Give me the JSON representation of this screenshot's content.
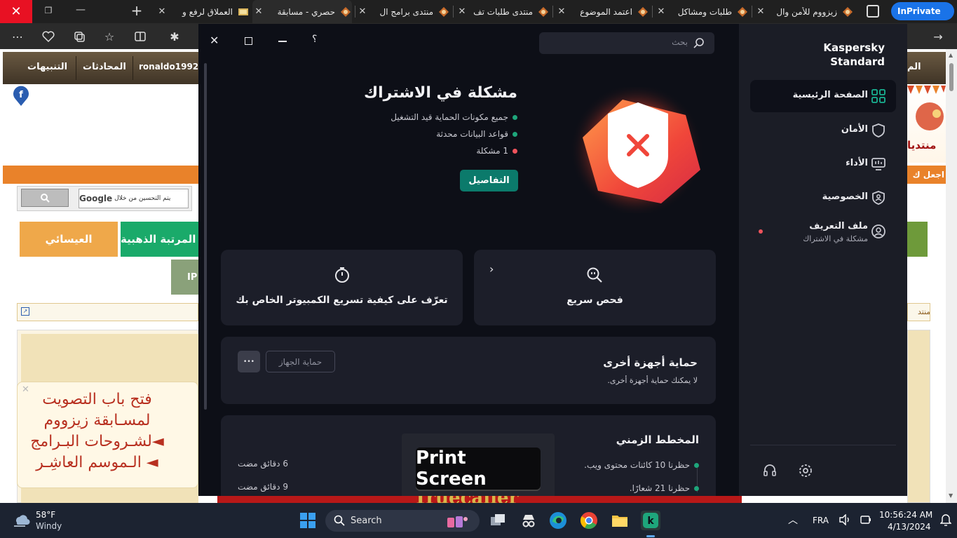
{
  "browser": {
    "tabs": [
      {
        "label": "العملاق لرفع و",
        "active": false
      },
      {
        "label": "حصري - مسابقة",
        "active": true
      },
      {
        "label": "منتدى برامج ال",
        "active": false
      },
      {
        "label": "منتدى طلبات تف",
        "active": false
      },
      {
        "label": "اعتمد الموضوع",
        "active": false
      },
      {
        "label": "طلبات ومشاكل",
        "active": false
      },
      {
        "label": "زيزووم للأمن وال",
        "active": false
      }
    ],
    "inprivate_label": "InPrivate"
  },
  "forum": {
    "nav": {
      "alerts": "التنبيهات",
      "conversations": "المحادثات",
      "username": "ronaldo1992"
    },
    "search_placeholder": "يتم التحسين من خلال",
    "google_word": "Google",
    "right_nav_label": "الم",
    "join_text": "اجعل ك",
    "brand_text": "منتديا",
    "rank_gold": "المرتبة الذهبية",
    "rank_other": "العيسائي",
    "ip_label": "IP",
    "breadcrumb_right": "المنتد",
    "announcement": {
      "line1": "فتح باب التصويت",
      "line2": "لمسـابقة زيزووم",
      "line3": "◄لشـروحات البـرامج",
      "line4": "◄ الـموسم العاشِـر"
    },
    "truecaller_text": "Truecaller"
  },
  "kaspersky": {
    "app_name_line1": "Kaspersky",
    "app_name_line2": "Standard",
    "search_placeholder": "بحث",
    "sidebar": [
      {
        "label": "الصفحة الرئيسية",
        "icon": "dashboard-icon",
        "active": true
      },
      {
        "label": "الأمان",
        "icon": "shield-icon",
        "active": false
      },
      {
        "label": "الأداء",
        "icon": "monitor-icon",
        "active": false
      },
      {
        "label": "الخصوصية",
        "icon": "privacy-shield-icon",
        "active": false
      },
      {
        "label": "ملف التعريف",
        "sublabel": "مشكلة في الاشتراك",
        "icon": "profile-icon",
        "active": false
      }
    ],
    "status": {
      "title": "مشكلة في الاشتراك",
      "items": [
        {
          "text": "جميع مكونات الحماية قيد التشغيل",
          "state": "ok"
        },
        {
          "text": "قواعد البيانات محدثة",
          "state": "ok"
        },
        {
          "text": "1 مشكلة",
          "state": "error"
        }
      ],
      "details_button": "التفاصيل"
    },
    "cards": {
      "quick_scan": "فحص سريع",
      "speed_up": "تعرّف على كيفية تسريع الكمبيوتر الخاص بك"
    },
    "other_devices": {
      "title": "حماية أجهزة أخرى",
      "subtitle": "لا يمكنك حماية أجهزة أخرى.",
      "button": "حماية الجهاز",
      "more": "•••"
    },
    "timeline": {
      "title": "المخطط الزمني",
      "events": [
        {
          "text": "حظرنا 10 كائنات محتوى ويب.",
          "time": "6 دقائق مضت"
        },
        {
          "text": "حظرنا 21 شعارًا.",
          "time": "9 دقائق مضت"
        }
      ]
    },
    "overlay_label": "Print Screen",
    "colors": {
      "ok": "#1ea67b",
      "error": "#f0535c",
      "accent": "#0b7a6b"
    }
  },
  "taskbar": {
    "weather_temp": "58°F",
    "weather_desc": "Windy",
    "search_label": "Search",
    "language": "FRA",
    "time": "10:56:24 AM",
    "date": "4/13/2024"
  }
}
